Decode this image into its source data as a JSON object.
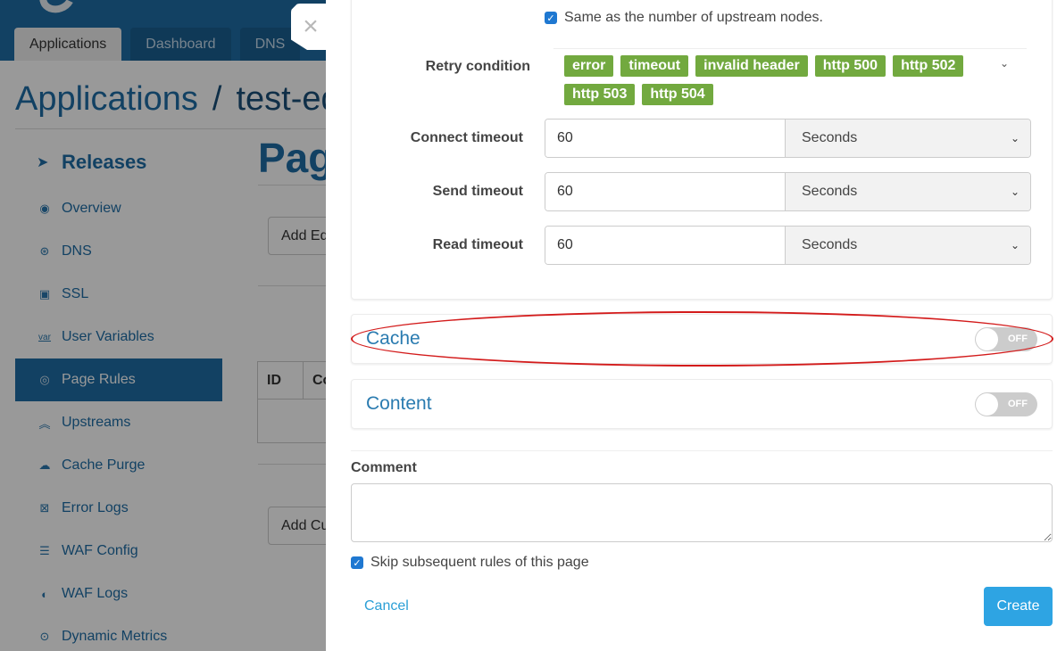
{
  "topnav": {
    "tabs": [
      {
        "label": "Applications",
        "active": true
      },
      {
        "label": "Dashboard",
        "active": false
      },
      {
        "label": "DNS",
        "active": false
      }
    ]
  },
  "breadcrumb": {
    "root": "Applications",
    "separator": "/",
    "app": "test-ed"
  },
  "sidebar": {
    "header": {
      "label": "Releases",
      "icon": "paper-plane-icon"
    },
    "items": [
      {
        "label": "Overview",
        "icon": "gauge-icon",
        "active": false
      },
      {
        "label": "DNS",
        "icon": "globe-icon",
        "active": false
      },
      {
        "label": "SSL",
        "icon": "lock-card-icon",
        "active": false
      },
      {
        "label": "User Variables",
        "icon": "var-icon",
        "active": false
      },
      {
        "label": "Page Rules",
        "icon": "compass-icon",
        "active": true
      },
      {
        "label": "Upstreams",
        "icon": "double-chevron-up-icon",
        "active": false
      },
      {
        "label": "Cache Purge",
        "icon": "cloud-icon",
        "active": false
      },
      {
        "label": "Error Logs",
        "icon": "error-doc-icon",
        "active": false
      },
      {
        "label": "WAF Config",
        "icon": "list-icon",
        "active": false
      },
      {
        "label": "WAF Logs",
        "icon": "shield-log-icon",
        "active": false
      },
      {
        "label": "Dynamic Metrics",
        "icon": "pin-circle-icon",
        "active": false
      }
    ]
  },
  "content": {
    "title": "Page",
    "add_edge_btn": "Add Ed",
    "add_custom_btn": "Add Cu",
    "table_headers": [
      "ID",
      "Co"
    ]
  },
  "drawer": {
    "close_icon": "×",
    "same_as_upstream": {
      "label": "Same as the number of upstream nodes.",
      "checked": true
    },
    "retry_condition": {
      "label": "Retry condition",
      "tags": [
        "error",
        "timeout",
        "invalid header",
        "http 500",
        "http 502",
        "http 503",
        "http 504"
      ]
    },
    "timeouts": [
      {
        "label": "Connect timeout",
        "value": "60",
        "unit": "Seconds"
      },
      {
        "label": "Send timeout",
        "value": "60",
        "unit": "Seconds"
      },
      {
        "label": "Read timeout",
        "value": "60",
        "unit": "Seconds"
      }
    ],
    "sections": [
      {
        "title": "Cache",
        "state": "OFF",
        "highlighted": true
      },
      {
        "title": "Content",
        "state": "OFF",
        "highlighted": false
      }
    ],
    "comment": {
      "label": "Comment",
      "value": ""
    },
    "skip_rules": {
      "label": "Skip subsequent rules of this page",
      "checked": true
    },
    "cancel_label": "Cancel",
    "create_label": "Create"
  },
  "colors": {
    "brand": "#1e6da6",
    "tag_green": "#72a93f",
    "primary_button": "#2ea4e3",
    "annotation_red": "#d31b1b"
  }
}
